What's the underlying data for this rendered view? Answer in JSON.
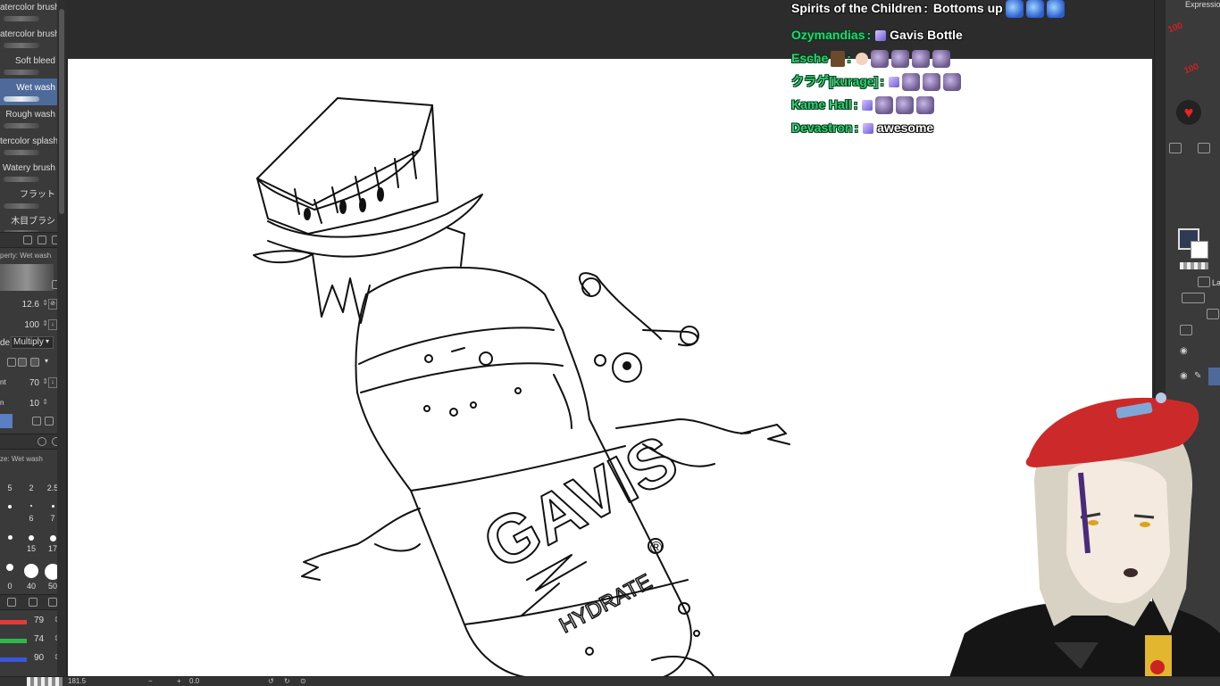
{
  "brushes": [
    {
      "label": "atercolor brush",
      "selected": false
    },
    {
      "label": "atercolor brush",
      "selected": false
    },
    {
      "label": "Soft bleed",
      "selected": false
    },
    {
      "label": "Wet wash",
      "selected": true
    },
    {
      "label": "Rough wash",
      "selected": false
    },
    {
      "label": "tercolor splash",
      "selected": false
    },
    {
      "label": "Watery brush",
      "selected": false
    },
    {
      "label": "フラット",
      "selected": false
    },
    {
      "label": "木目ブラシ",
      "selected": false
    }
  ],
  "tool_property": {
    "title": "perty: Wet wash",
    "size": "12.6",
    "opacity": "100",
    "blend_label": "de",
    "blend_value": "Multiply",
    "row_a_label": "nt",
    "row_a_value": "70",
    "row_b_label": "n",
    "row_b_value": "10"
  },
  "brush_size": {
    "title": "ze: Wet wash",
    "values": [
      "5",
      "2",
      "2.5",
      "",
      "6",
      "7",
      "",
      "15",
      "17",
      "0",
      "40",
      "50"
    ]
  },
  "color_sliders": [
    {
      "value": "79",
      "color": "#e23b3b"
    },
    {
      "value": "74",
      "color": "#2fb84a"
    },
    {
      "value": "90",
      "color": "#3a56d8"
    }
  ],
  "chat": [
    {
      "user": "Spirits of the Children",
      "user_white": true,
      "badge": false,
      "emote_before": [],
      "message": "Bottoms up",
      "emotes_after": [
        "blue",
        "blue",
        "blue"
      ]
    },
    {
      "user": "Ozymandias",
      "user_white": false,
      "badge": true,
      "emote_before": [],
      "message": "Gavis Bottle",
      "emotes_after": []
    },
    {
      "user": "Esche",
      "user_white": false,
      "badge": false,
      "emote_before": [
        "book"
      ],
      "message": "",
      "emotes_after": [
        "hand",
        "purple",
        "purple",
        "purple",
        "purple"
      ]
    },
    {
      "user": "クラゲ[kurage]",
      "user_white": false,
      "badge": true,
      "emote_before": [],
      "message": "",
      "emotes_after": [
        "purple",
        "purple",
        "purple"
      ]
    },
    {
      "user": "Kame Hall",
      "user_white": false,
      "badge": true,
      "emote_before": [],
      "message": "",
      "emotes_after": [
        "purple",
        "purple",
        "purple"
      ]
    },
    {
      "user": "Devastron",
      "user_white": false,
      "badge": true,
      "emote_before": [],
      "message": "awesome",
      "emotes_after": []
    }
  ],
  "chat_separator": ":",
  "bottle_label": {
    "brand": "GAVIS",
    "sub": "HYDRATE",
    "mark": "®"
  },
  "right_panel": {
    "top_label": "Expressio",
    "layer_label": "Lay"
  },
  "status_bar": {
    "zoom": "181.5",
    "rotation": "0.0"
  },
  "colors": {
    "main_color": "#2f3a55",
    "sub_color": "#ffffff",
    "beret": "#cc2a2a",
    "hair": "#d8d2c4"
  }
}
